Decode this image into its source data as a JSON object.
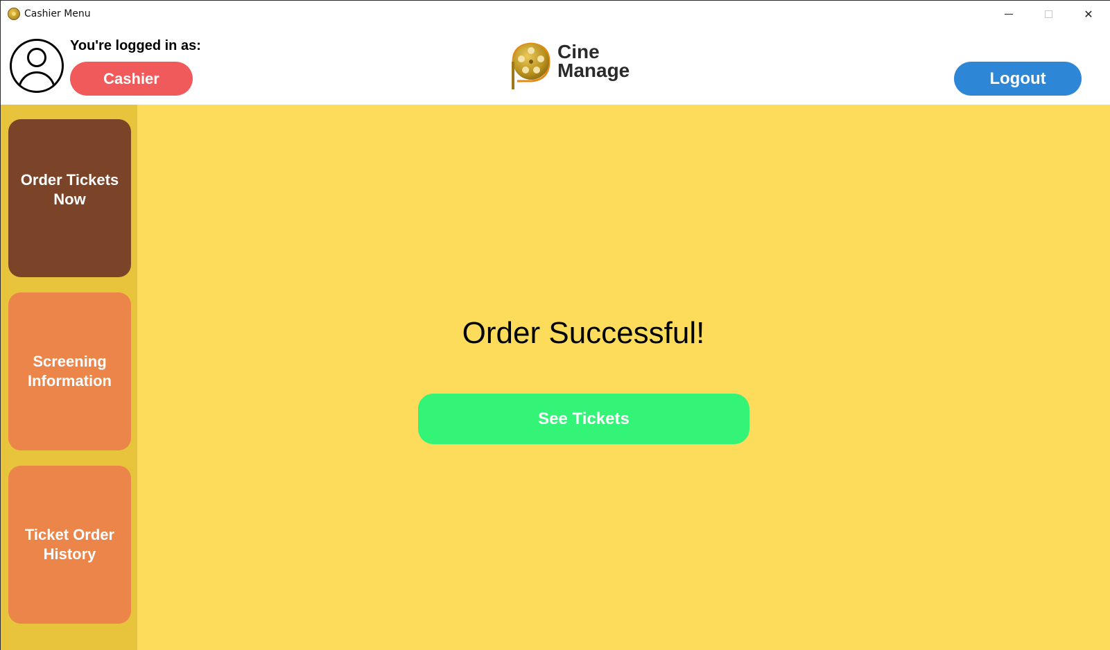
{
  "window": {
    "title": "Cashier Menu",
    "minimize_icon": "minimize-icon",
    "maximize_icon": "maximize-icon",
    "close_symbol": "✕"
  },
  "header": {
    "logged_in_label": "You're logged in as:",
    "role": "Cashier",
    "brand_name_line1": "Cine",
    "brand_name_line2": "Manage",
    "logout_label": "Logout"
  },
  "sidebar": {
    "items": [
      {
        "label_line1": "Order Tickets",
        "label_line2": "Now",
        "active": true
      },
      {
        "label_line1": "Screening",
        "label_line2": "Information",
        "active": false
      },
      {
        "label_line1": "Ticket Order",
        "label_line2": "History",
        "active": false
      }
    ]
  },
  "main": {
    "message": "Order Successful!",
    "see_tickets_label": "See Tickets"
  },
  "colors": {
    "sidebar_bg": "#e8c43c",
    "main_bg": "#fddc5c",
    "active_nav": "#7b4428",
    "nav": "#ec854a",
    "role_pill": "#f15a5a",
    "logout": "#2e86d6",
    "see_tickets": "#34f478"
  }
}
